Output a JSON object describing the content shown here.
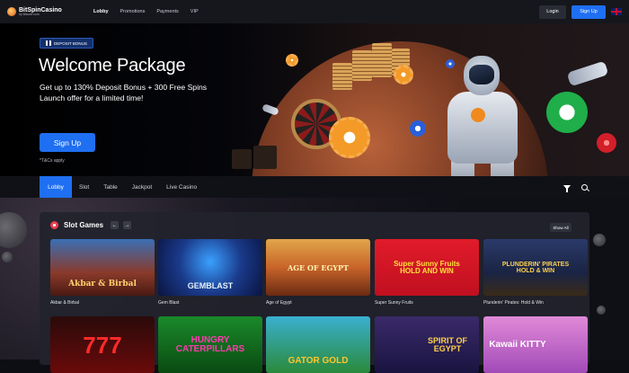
{
  "header": {
    "logo_name": "BitSpinCasino",
    "logo_sub": "by Bitcoin.com",
    "nav": [
      "Lobby",
      "Promotions",
      "Payments",
      "VIP"
    ],
    "login_label": "Login",
    "signup_label": "Sign Up"
  },
  "hero": {
    "badge": "DEPOSIT BONUS",
    "title": "Welcome Package",
    "line1": "Get up to 130% Deposit Bonus + 300 Free Spins",
    "line2": "Launch offer for a limited time!",
    "cta": "Sign Up",
    "terms": "*T&Cs apply"
  },
  "categories": {
    "tabs": [
      "Lobby",
      "Slot",
      "Table",
      "Jackpot",
      "Live Casino"
    ]
  },
  "slots": {
    "title": "Slot Games",
    "prev": "←",
    "next": "→",
    "show_all": "Show All",
    "row1": [
      {
        "name": "Akbar & Birbal",
        "art": "Akbar & Birbal"
      },
      {
        "name": "Gem Blast",
        "art": "GEMBLAST"
      },
      {
        "name": "Age of Egypt",
        "art": "AGE OF EGYPT"
      },
      {
        "name": "Super Sunny Fruits",
        "art": "Super Sunny Fruits HOLD AND WIN"
      },
      {
        "name": "Plunderin' Pirates: Hold & Win",
        "art": "PLUNDERIN' PIRATES HOLD & WIN"
      }
    ],
    "row2": [
      {
        "art": "777"
      },
      {
        "art": "HUNGRY CATERPILLARS"
      },
      {
        "art": "GATOR GOLD"
      },
      {
        "art": "SPIRIT OF EGYPT"
      },
      {
        "art": "Kawaii KITTY"
      }
    ]
  },
  "colors": {
    "accent": "#1f6ff2",
    "topbar": "#16171d",
    "panel": "#22232d"
  }
}
